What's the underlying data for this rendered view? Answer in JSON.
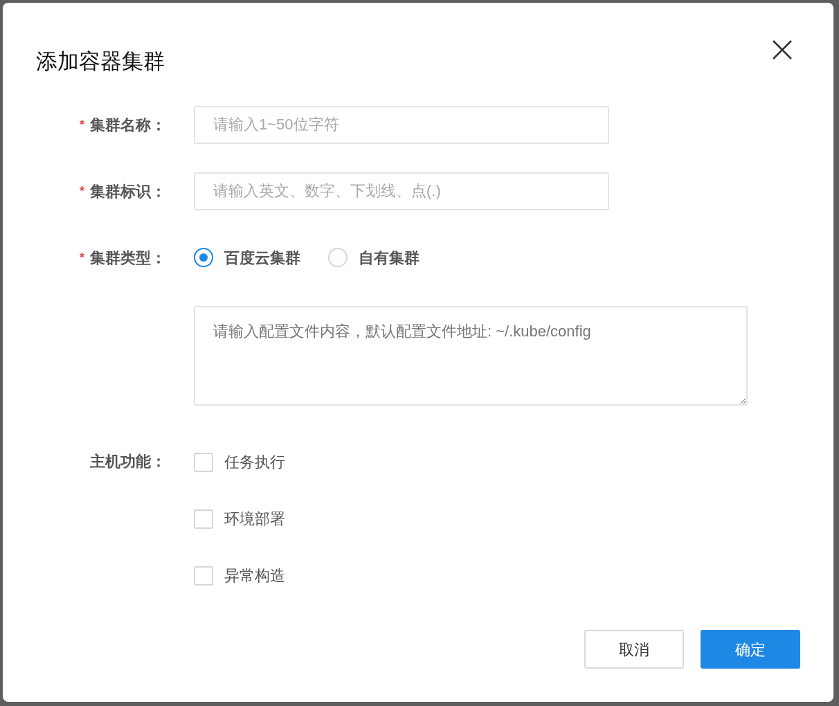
{
  "dialog": {
    "title": "添加容器集群",
    "fields": [
      {
        "kind": "text",
        "marker": "*",
        "label": "集群名称：",
        "placeholder": "请输入1~50位字符"
      },
      {
        "kind": "text",
        "marker": "*",
        "label": "集群标识：",
        "placeholder": "请输入英文、数字、下划线、点(.)"
      },
      {
        "kind": "radio",
        "marker": "*",
        "label": "集群类型：",
        "options": [
          {
            "label": "百度云集群",
            "selected": true
          },
          {
            "label": "自有集群",
            "selected": false
          }
        ]
      },
      {
        "kind": "textarea",
        "placeholder": "请输入配置文件内容，默认配置文件地址: ~/.kube/config"
      },
      {
        "kind": "checkbox",
        "label": "主机功能：",
        "options": [
          {
            "label": "任务执行",
            "checked": false
          },
          {
            "label": "环境部署",
            "checked": false
          },
          {
            "label": "异常构造",
            "checked": false
          }
        ]
      }
    ],
    "buttons": [
      {
        "label": "取消",
        "primary": false
      },
      {
        "label": "确定",
        "primary": true
      }
    ]
  }
}
